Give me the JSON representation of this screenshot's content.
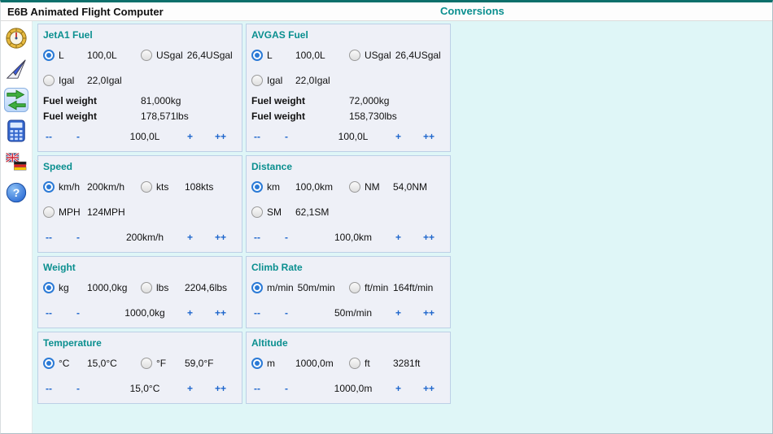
{
  "app": {
    "title": "E6B Animated Flight Computer",
    "page_title": "Conversions"
  },
  "colors": {
    "accent_teal": "#0a8f8f",
    "link_blue": "#1e66cc",
    "radio_blue": "#2b7ad6",
    "main_background": "#dff6f7",
    "panel_background": "#eef0f7",
    "panel_border": "#bcd0e6"
  },
  "sidebar": {
    "items": [
      {
        "icon": "e6b-computer-icon",
        "active": false
      },
      {
        "icon": "paper-plane-icon",
        "active": false
      },
      {
        "icon": "swap-arrows-icon",
        "active": true
      },
      {
        "icon": "calculator-icon",
        "active": false
      },
      {
        "icon": "language-flags-icon",
        "active": false
      },
      {
        "icon": "help-icon",
        "active": false,
        "glyph": "?"
      }
    ]
  },
  "panels": [
    {
      "title": "JetA1 Fuel",
      "option_rows": [
        [
          {
            "label": "L",
            "value": "100,0L",
            "selected": true
          },
          {
            "label": "USgal",
            "value": "26,4USgal",
            "selected": false
          }
        ],
        [
          {
            "label": "Igal",
            "value": "22,0Igal",
            "selected": false
          }
        ]
      ],
      "info_rows": [
        {
          "label": "Fuel weight",
          "value": "81,000kg"
        },
        {
          "label": "Fuel weight",
          "value": "178,571lbs"
        }
      ],
      "stepper": {
        "dec2": "--",
        "dec": "-",
        "value": "100,0L",
        "inc": "+",
        "inc2": "++"
      }
    },
    {
      "title": "AVGAS Fuel",
      "option_rows": [
        [
          {
            "label": "L",
            "value": "100,0L",
            "selected": true
          },
          {
            "label": "USgal",
            "value": "26,4USgal",
            "selected": false
          }
        ],
        [
          {
            "label": "Igal",
            "value": "22,0Igal",
            "selected": false
          }
        ]
      ],
      "info_rows": [
        {
          "label": "Fuel weight",
          "value": "72,000kg"
        },
        {
          "label": "Fuel weight",
          "value": "158,730lbs"
        }
      ],
      "stepper": {
        "dec2": "--",
        "dec": "-",
        "value": "100,0L",
        "inc": "+",
        "inc2": "++"
      }
    },
    {
      "title": "Speed",
      "option_rows": [
        [
          {
            "label": "km/h",
            "value": "200km/h",
            "selected": true
          },
          {
            "label": "kts",
            "value": "108kts",
            "selected": false
          }
        ],
        [
          {
            "label": "MPH",
            "value": "124MPH",
            "selected": false
          }
        ]
      ],
      "info_rows": [],
      "stepper": {
        "dec2": "--",
        "dec": "-",
        "value": "200km/h",
        "inc": "+",
        "inc2": "++"
      }
    },
    {
      "title": "Distance",
      "option_rows": [
        [
          {
            "label": "km",
            "value": "100,0km",
            "selected": true
          },
          {
            "label": "NM",
            "value": "54,0NM",
            "selected": false
          }
        ],
        [
          {
            "label": "SM",
            "value": "62,1SM",
            "selected": false
          }
        ]
      ],
      "info_rows": [],
      "stepper": {
        "dec2": "--",
        "dec": "-",
        "value": "100,0km",
        "inc": "+",
        "inc2": "++"
      }
    },
    {
      "title": "Weight",
      "option_rows": [
        [
          {
            "label": "kg",
            "value": "1000,0kg",
            "selected": true
          },
          {
            "label": "lbs",
            "value": "2204,6lbs",
            "selected": false
          }
        ]
      ],
      "info_rows": [],
      "stepper": {
        "dec2": "--",
        "dec": "-",
        "value": "1000,0kg",
        "inc": "+",
        "inc2": "++"
      }
    },
    {
      "title": "Climb Rate",
      "option_rows": [
        [
          {
            "label": "m/min",
            "value": "50m/min",
            "selected": true
          },
          {
            "label": "ft/min",
            "value": "164ft/min",
            "selected": false
          }
        ]
      ],
      "info_rows": [],
      "stepper": {
        "dec2": "--",
        "dec": "-",
        "value": "50m/min",
        "inc": "+",
        "inc2": "++"
      }
    },
    {
      "title": "Temperature",
      "option_rows": [
        [
          {
            "label": "°C",
            "value": "15,0°C",
            "selected": true
          },
          {
            "label": "°F",
            "value": "59,0°F",
            "selected": false
          }
        ]
      ],
      "info_rows": [],
      "stepper": {
        "dec2": "--",
        "dec": "-",
        "value": "15,0°C",
        "inc": "+",
        "inc2": "++"
      }
    },
    {
      "title": "Altitude",
      "option_rows": [
        [
          {
            "label": "m",
            "value": "1000,0m",
            "selected": true
          },
          {
            "label": "ft",
            "value": "3281ft",
            "selected": false
          }
        ]
      ],
      "info_rows": [],
      "stepper": {
        "dec2": "--",
        "dec": "-",
        "value": "1000,0m",
        "inc": "+",
        "inc2": "++"
      }
    }
  ]
}
